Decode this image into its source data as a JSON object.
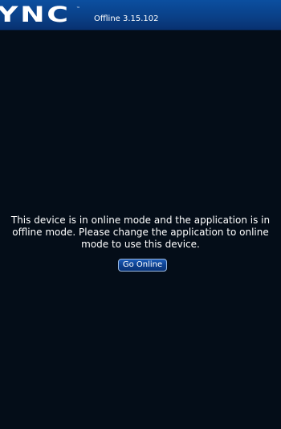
{
  "header": {
    "logo_text": "YNC",
    "trademark": "™",
    "version_label": "Offline 3.15.102"
  },
  "main": {
    "message": "This device is in online mode and the application is in\noffline mode.  Please change the application to online\nmode to use this device.",
    "go_online_label": "Go Online"
  },
  "colors": {
    "background": "#040d18",
    "header": "#0a3f86",
    "button": "#0c3f8e",
    "text": "#ffffff"
  }
}
